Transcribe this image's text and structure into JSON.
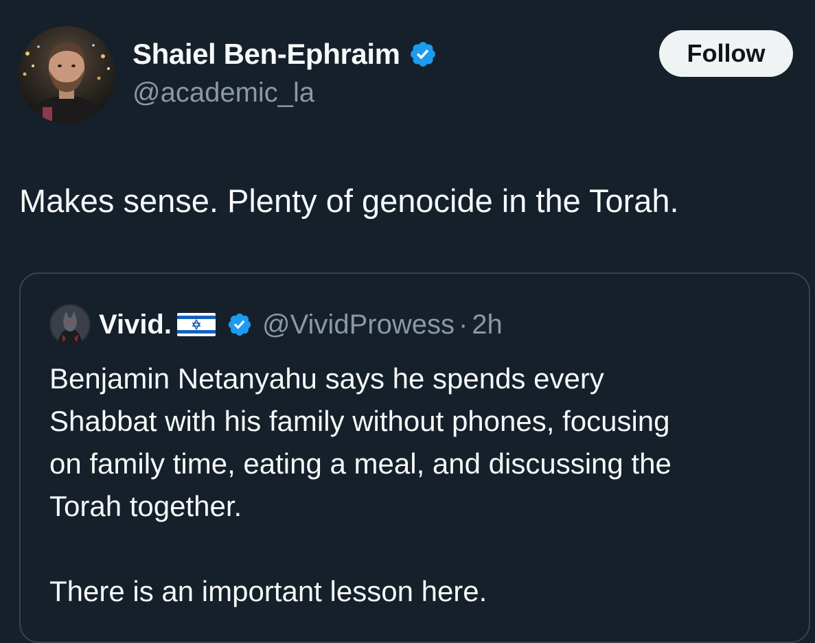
{
  "post": {
    "author": {
      "name": "Shaiel Ben-Ephraim",
      "handle": "@academic_la",
      "verified": true
    },
    "follow_label": "Follow",
    "text": "Makes sense. Plenty of genocide in the Torah."
  },
  "quoted_post": {
    "author": {
      "name": "Vivid.",
      "flag": "israel-flag-icon",
      "handle": "@VividProwess",
      "verified": true
    },
    "separator": "·",
    "time": "2h",
    "lines": [
      "Benjamin Netanyahu says he spends every",
      "Shabbat with his family without phones, focusing",
      "on family time, eating a meal, and discussing the",
      "Torah together."
    ],
    "second_paragraph": "There is an important lesson here."
  },
  "colors": {
    "background": "#15202b",
    "text": "#f7f9f9",
    "secondary_text": "#8b98a5",
    "verified_blue": "#1d9bf0",
    "follow_bg": "#eff3f4",
    "border": "#38444d"
  }
}
